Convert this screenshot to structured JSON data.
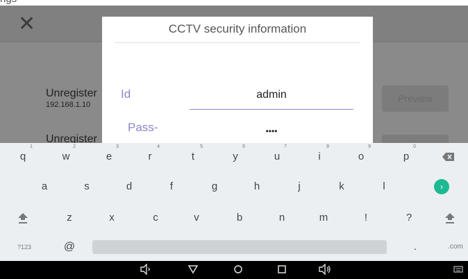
{
  "top_cut_text": "ngs",
  "app": {
    "close_glyph": "✕",
    "cameras": [
      {
        "name": "Unregister",
        "ip": "192.168.1.10"
      },
      {
        "name": "Unregister",
        "ip": ""
      }
    ],
    "preview_label": "Preview"
  },
  "dialog": {
    "title": "CCTV security information",
    "id_label": "Id",
    "id_value": "admin",
    "pass_label": "Pass-",
    "pass_value": "••••"
  },
  "keyboard": {
    "row1": [
      {
        "k": "q",
        "h": "1"
      },
      {
        "k": "w",
        "h": "2"
      },
      {
        "k": "e",
        "h": "3"
      },
      {
        "k": "r",
        "h": "4"
      },
      {
        "k": "t",
        "h": "5"
      },
      {
        "k": "y",
        "h": "6"
      },
      {
        "k": "u",
        "h": "7"
      },
      {
        "k": "i",
        "h": "8"
      },
      {
        "k": "o",
        "h": "9"
      },
      {
        "k": "p",
        "h": "0"
      }
    ],
    "row2": [
      "a",
      "s",
      "d",
      "f",
      "g",
      "h",
      "j",
      "k",
      "l"
    ],
    "row3": [
      "z",
      "x",
      "c",
      "v",
      "b",
      "n",
      "m",
      "!",
      "?"
    ],
    "symbols_label": "?123",
    "at_label": "@",
    "dot_label": ".",
    "com_label": ".com",
    "icons": {
      "backspace": "backspace-icon",
      "enter": "enter-icon",
      "shift": "shift-icon"
    },
    "accent_color": "#1db992"
  },
  "navbar": {
    "icons": [
      "volume-down-icon",
      "back-icon",
      "home-icon",
      "recents-icon",
      "volume-up-icon",
      "keyboard-icon"
    ]
  }
}
